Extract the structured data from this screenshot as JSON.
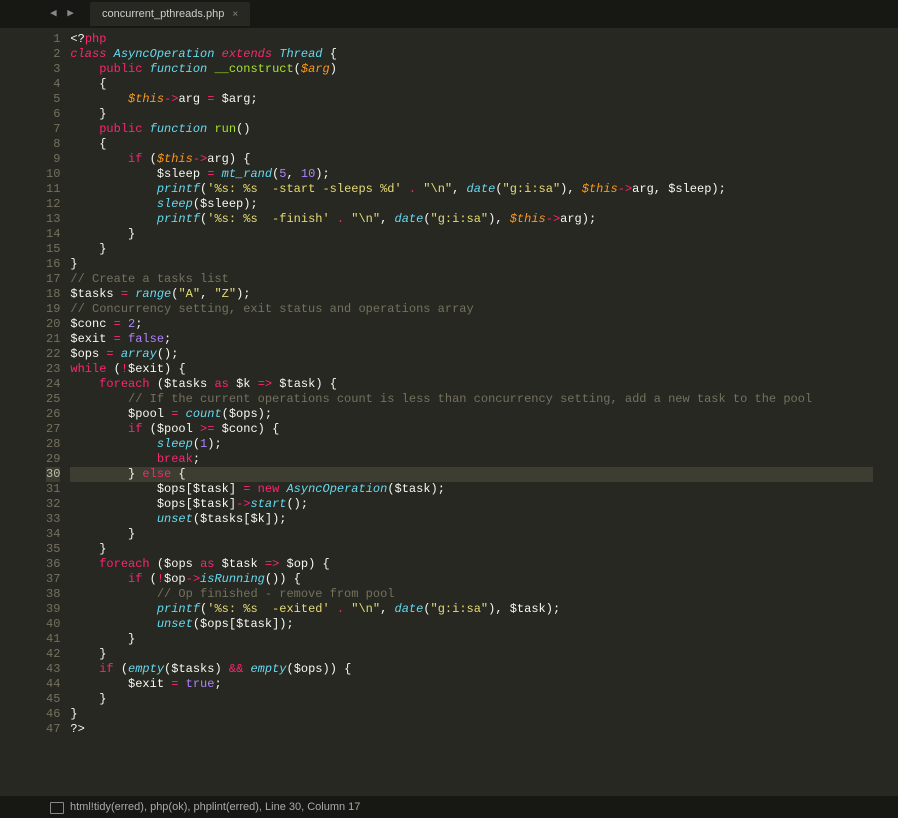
{
  "tab": {
    "title": "concurrent_pthreads.php",
    "close": "×"
  },
  "nav": {
    "arrows": "◀ ▶"
  },
  "gutter": {
    "start": 1,
    "end": 47,
    "active": 30
  },
  "status": {
    "text": "html!tidy(erred), php(ok), phplint(erred), Line 30, Column 17"
  },
  "code": {
    "l1": [
      [
        "tag",
        "<?"
      ],
      [
        "kw2",
        "php"
      ]
    ],
    "l2": [
      [
        "kw",
        "class"
      ],
      [
        "pn",
        " "
      ],
      [
        "cls",
        "AsyncOperation"
      ],
      [
        "pn",
        " "
      ],
      [
        "kw",
        "extends"
      ],
      [
        "pn",
        " "
      ],
      [
        "cls",
        "Thread"
      ],
      [
        "pn",
        " {"
      ]
    ],
    "l3": [
      [
        "pn",
        "    "
      ],
      [
        "kw2",
        "public"
      ],
      [
        "pn",
        " "
      ],
      [
        "fn",
        "function"
      ],
      [
        "pn",
        " "
      ],
      [
        "name",
        "__construct"
      ],
      [
        "pn",
        "("
      ],
      [
        "var",
        "$arg"
      ],
      [
        "pn",
        ")"
      ]
    ],
    "l4": [
      [
        "pn",
        "    {"
      ]
    ],
    "l5": [
      [
        "pn",
        "        "
      ],
      [
        "var",
        "$this"
      ],
      [
        "op",
        "->"
      ],
      [
        "varw",
        "arg"
      ],
      [
        "pn",
        " "
      ],
      [
        "op",
        "="
      ],
      [
        "pn",
        " "
      ],
      [
        "varw",
        "$arg"
      ],
      [
        "pn",
        ";"
      ]
    ],
    "l6": [
      [
        "pn",
        "    }"
      ]
    ],
    "l7": [
      [
        "pn",
        "    "
      ],
      [
        "kw2",
        "public"
      ],
      [
        "pn",
        " "
      ],
      [
        "fn",
        "function"
      ],
      [
        "pn",
        " "
      ],
      [
        "name",
        "run"
      ],
      [
        "pn",
        "()"
      ]
    ],
    "l8": [
      [
        "pn",
        "    {"
      ]
    ],
    "l9": [
      [
        "pn",
        "        "
      ],
      [
        "kw2",
        "if"
      ],
      [
        "pn",
        " ("
      ],
      [
        "var",
        "$this"
      ],
      [
        "op",
        "->"
      ],
      [
        "varw",
        "arg"
      ],
      [
        "pn",
        ") {"
      ]
    ],
    "l10": [
      [
        "pn",
        "            "
      ],
      [
        "varw",
        "$sleep"
      ],
      [
        "pn",
        " "
      ],
      [
        "op",
        "="
      ],
      [
        "pn",
        " "
      ],
      [
        "fn",
        "mt_rand"
      ],
      [
        "pn",
        "("
      ],
      [
        "num",
        "5"
      ],
      [
        "pn",
        ", "
      ],
      [
        "num",
        "10"
      ],
      [
        "pn",
        ");"
      ]
    ],
    "l11": [
      [
        "pn",
        "            "
      ],
      [
        "fn",
        "printf"
      ],
      [
        "pn",
        "("
      ],
      [
        "str",
        "'%s: %s  -start -sleeps %d'"
      ],
      [
        "pn",
        " "
      ],
      [
        "op",
        "."
      ],
      [
        "pn",
        " "
      ],
      [
        "str",
        "\"\\n\""
      ],
      [
        "pn",
        ", "
      ],
      [
        "fn",
        "date"
      ],
      [
        "pn",
        "("
      ],
      [
        "str",
        "\"g:i:sa\""
      ],
      [
        "pn",
        "), "
      ],
      [
        "var",
        "$this"
      ],
      [
        "op",
        "->"
      ],
      [
        "varw",
        "arg"
      ],
      [
        "pn",
        ", "
      ],
      [
        "varw",
        "$sleep"
      ],
      [
        "pn",
        ");"
      ]
    ],
    "l12": [
      [
        "pn",
        "            "
      ],
      [
        "fn",
        "sleep"
      ],
      [
        "pn",
        "("
      ],
      [
        "varw",
        "$sleep"
      ],
      [
        "pn",
        ");"
      ]
    ],
    "l13": [
      [
        "pn",
        "            "
      ],
      [
        "fn",
        "printf"
      ],
      [
        "pn",
        "("
      ],
      [
        "str",
        "'%s: %s  -finish'"
      ],
      [
        "pn",
        " "
      ],
      [
        "op",
        "."
      ],
      [
        "pn",
        " "
      ],
      [
        "str",
        "\"\\n\""
      ],
      [
        "pn",
        ", "
      ],
      [
        "fn",
        "date"
      ],
      [
        "pn",
        "("
      ],
      [
        "str",
        "\"g:i:sa\""
      ],
      [
        "pn",
        "), "
      ],
      [
        "var",
        "$this"
      ],
      [
        "op",
        "->"
      ],
      [
        "varw",
        "arg"
      ],
      [
        "pn",
        ");"
      ]
    ],
    "l14": [
      [
        "pn",
        "        }"
      ]
    ],
    "l15": [
      [
        "pn",
        "    }"
      ]
    ],
    "l16": [
      [
        "pn",
        "}"
      ]
    ],
    "l17": [
      [
        "cmt",
        "// Create a tasks list"
      ]
    ],
    "l18": [
      [
        "varw",
        "$tasks"
      ],
      [
        "pn",
        " "
      ],
      [
        "op",
        "="
      ],
      [
        "pn",
        " "
      ],
      [
        "fn",
        "range"
      ],
      [
        "pn",
        "("
      ],
      [
        "str",
        "\"A\""
      ],
      [
        "pn",
        ", "
      ],
      [
        "str",
        "\"Z\""
      ],
      [
        "pn",
        ");"
      ]
    ],
    "l19": [
      [
        "cmt",
        "// Concurrency setting, exit status and operations array"
      ]
    ],
    "l20": [
      [
        "varw",
        "$conc"
      ],
      [
        "pn",
        " "
      ],
      [
        "op",
        "="
      ],
      [
        "pn",
        " "
      ],
      [
        "num",
        "2"
      ],
      [
        "pn",
        ";"
      ]
    ],
    "l21": [
      [
        "varw",
        "$exit"
      ],
      [
        "pn",
        " "
      ],
      [
        "op",
        "="
      ],
      [
        "pn",
        " "
      ],
      [
        "const",
        "false"
      ],
      [
        "pn",
        ";"
      ]
    ],
    "l22": [
      [
        "varw",
        "$ops"
      ],
      [
        "pn",
        " "
      ],
      [
        "op",
        "="
      ],
      [
        "pn",
        " "
      ],
      [
        "fn",
        "array"
      ],
      [
        "pn",
        "();"
      ]
    ],
    "l23": [
      [
        "kw2",
        "while"
      ],
      [
        "pn",
        " ("
      ],
      [
        "op",
        "!"
      ],
      [
        "varw",
        "$exit"
      ],
      [
        "pn",
        ") {"
      ]
    ],
    "l24": [
      [
        "pn",
        "    "
      ],
      [
        "kw2",
        "foreach"
      ],
      [
        "pn",
        " ("
      ],
      [
        "varw",
        "$tasks"
      ],
      [
        "pn",
        " "
      ],
      [
        "kw2",
        "as"
      ],
      [
        "pn",
        " "
      ],
      [
        "varw",
        "$k"
      ],
      [
        "pn",
        " "
      ],
      [
        "op",
        "=>"
      ],
      [
        "pn",
        " "
      ],
      [
        "varw",
        "$task"
      ],
      [
        "pn",
        ") {"
      ]
    ],
    "l25": [
      [
        "pn",
        "        "
      ],
      [
        "cmt",
        "// If the current operations count is less than concurrency setting, add a new task to the pool"
      ]
    ],
    "l26": [
      [
        "pn",
        "        "
      ],
      [
        "varw",
        "$pool"
      ],
      [
        "pn",
        " "
      ],
      [
        "op",
        "="
      ],
      [
        "pn",
        " "
      ],
      [
        "fn",
        "count"
      ],
      [
        "pn",
        "("
      ],
      [
        "varw",
        "$ops"
      ],
      [
        "pn",
        ");"
      ]
    ],
    "l27": [
      [
        "pn",
        "        "
      ],
      [
        "kw2",
        "if"
      ],
      [
        "pn",
        " ("
      ],
      [
        "varw",
        "$pool"
      ],
      [
        "pn",
        " "
      ],
      [
        "op",
        ">="
      ],
      [
        "pn",
        " "
      ],
      [
        "varw",
        "$conc"
      ],
      [
        "pn",
        ") {"
      ]
    ],
    "l28": [
      [
        "pn",
        "            "
      ],
      [
        "fn",
        "sleep"
      ],
      [
        "pn",
        "("
      ],
      [
        "num",
        "1"
      ],
      [
        "pn",
        ");"
      ]
    ],
    "l29": [
      [
        "pn",
        "            "
      ],
      [
        "kw2",
        "break"
      ],
      [
        "pn",
        ";"
      ]
    ],
    "l30": [
      [
        "pn",
        "        } "
      ],
      [
        "kw2",
        "else"
      ],
      [
        "pn",
        " {"
      ]
    ],
    "l31": [
      [
        "pn",
        "            "
      ],
      [
        "varw",
        "$ops"
      ],
      [
        "pn",
        "["
      ],
      [
        "varw",
        "$task"
      ],
      [
        "pn",
        "] "
      ],
      [
        "op",
        "="
      ],
      [
        "pn",
        " "
      ],
      [
        "op",
        "new"
      ],
      [
        "pn",
        " "
      ],
      [
        "cls",
        "AsyncOperation"
      ],
      [
        "pn",
        "("
      ],
      [
        "varw",
        "$task"
      ],
      [
        "pn",
        ");"
      ]
    ],
    "l32": [
      [
        "pn",
        "            "
      ],
      [
        "varw",
        "$ops"
      ],
      [
        "pn",
        "["
      ],
      [
        "varw",
        "$task"
      ],
      [
        "pn",
        "]"
      ],
      [
        "op",
        "->"
      ],
      [
        "fn",
        "start"
      ],
      [
        "pn",
        "();"
      ]
    ],
    "l33": [
      [
        "pn",
        "            "
      ],
      [
        "fn",
        "unset"
      ],
      [
        "pn",
        "("
      ],
      [
        "varw",
        "$tasks"
      ],
      [
        "pn",
        "["
      ],
      [
        "varw",
        "$k"
      ],
      [
        "pn",
        "]);"
      ]
    ],
    "l34": [
      [
        "pn",
        "        }"
      ]
    ],
    "l35": [
      [
        "pn",
        "    }"
      ]
    ],
    "l36": [
      [
        "pn",
        "    "
      ],
      [
        "kw2",
        "foreach"
      ],
      [
        "pn",
        " ("
      ],
      [
        "varw",
        "$ops"
      ],
      [
        "pn",
        " "
      ],
      [
        "kw2",
        "as"
      ],
      [
        "pn",
        " "
      ],
      [
        "varw",
        "$task"
      ],
      [
        "pn",
        " "
      ],
      [
        "op",
        "=>"
      ],
      [
        "pn",
        " "
      ],
      [
        "varw",
        "$op"
      ],
      [
        "pn",
        ") {"
      ]
    ],
    "l37": [
      [
        "pn",
        "        "
      ],
      [
        "kw2",
        "if"
      ],
      [
        "pn",
        " ("
      ],
      [
        "op",
        "!"
      ],
      [
        "varw",
        "$op"
      ],
      [
        "op",
        "->"
      ],
      [
        "fn",
        "isRunning"
      ],
      [
        "pn",
        "()) {"
      ]
    ],
    "l38": [
      [
        "pn",
        "            "
      ],
      [
        "cmt",
        "// Op finished - remove from pool"
      ]
    ],
    "l39": [
      [
        "pn",
        "            "
      ],
      [
        "fn",
        "printf"
      ],
      [
        "pn",
        "("
      ],
      [
        "str",
        "'%s: %s  -exited'"
      ],
      [
        "pn",
        " "
      ],
      [
        "op",
        "."
      ],
      [
        "pn",
        " "
      ],
      [
        "str",
        "\"\\n\""
      ],
      [
        "pn",
        ", "
      ],
      [
        "fn",
        "date"
      ],
      [
        "pn",
        "("
      ],
      [
        "str",
        "\"g:i:sa\""
      ],
      [
        "pn",
        "), "
      ],
      [
        "varw",
        "$task"
      ],
      [
        "pn",
        ");"
      ]
    ],
    "l40": [
      [
        "pn",
        "            "
      ],
      [
        "fn",
        "unset"
      ],
      [
        "pn",
        "("
      ],
      [
        "varw",
        "$ops"
      ],
      [
        "pn",
        "["
      ],
      [
        "varw",
        "$task"
      ],
      [
        "pn",
        "]);"
      ]
    ],
    "l41": [
      [
        "pn",
        "        }"
      ]
    ],
    "l42": [
      [
        "pn",
        "    }"
      ]
    ],
    "l43": [
      [
        "pn",
        "    "
      ],
      [
        "kw2",
        "if"
      ],
      [
        "pn",
        " ("
      ],
      [
        "fn",
        "empty"
      ],
      [
        "pn",
        "("
      ],
      [
        "varw",
        "$tasks"
      ],
      [
        "pn",
        ") "
      ],
      [
        "op",
        "&&"
      ],
      [
        "pn",
        " "
      ],
      [
        "fn",
        "empty"
      ],
      [
        "pn",
        "("
      ],
      [
        "varw",
        "$ops"
      ],
      [
        "pn",
        ")) {"
      ]
    ],
    "l44": [
      [
        "pn",
        "        "
      ],
      [
        "varw",
        "$exit"
      ],
      [
        "pn",
        " "
      ],
      [
        "op",
        "="
      ],
      [
        "pn",
        " "
      ],
      [
        "const",
        "true"
      ],
      [
        "pn",
        ";"
      ]
    ],
    "l45": [
      [
        "pn",
        "    }"
      ]
    ],
    "l46": [
      [
        "pn",
        "}"
      ]
    ],
    "l47": [
      [
        "tag",
        "?>"
      ]
    ]
  }
}
